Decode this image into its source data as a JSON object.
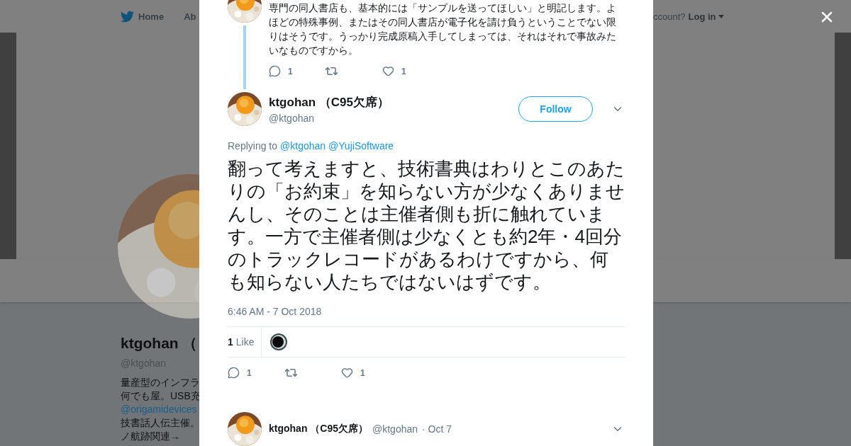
{
  "nav": {
    "home": "Home",
    "about": "Ab",
    "account_prompt": "ccount?",
    "login": "Log in"
  },
  "profile": {
    "name": "ktgohan （",
    "handle": "@ktgohan",
    "bio": [
      {
        "kind": "text",
        "text": "量産型のインフラ"
      },
      {
        "kind": "text",
        "text": "何でも屋。USB充"
      },
      {
        "kind": "link",
        "text": "@origamidevices"
      },
      {
        "kind": "text",
        "text": "技書話人伝主催。"
      },
      {
        "kind": "text",
        "text": "ノ航跡関連→"
      }
    ]
  },
  "previous_tweet": {
    "text": "専門の同人書店も、基本的には「サンプルを送ってほしい」と明記します。よほどの特殊事例、またはその同人書店が電子化を請け負うということでない限りはそうです。うっかり完成原稿入手してしまっては、それはそれで事故みたいなものですから。",
    "replies": "1",
    "likes": "1"
  },
  "tweet": {
    "name": "ktgohan （C95欠席）",
    "handle": "@ktgohan",
    "follow": "Follow",
    "replying_label": "Replying to",
    "replying_to": [
      "@ktgohan",
      "@YujiSoftware"
    ],
    "text": "翻って考えますと、技術書典はわりとこのあたりの「お約束」を知らない方が少なくありませんし、そのことは主催者側も折に触れています。一方で主催者側は少なくとも約2年・4回分のトラックレコードがあるわけですから、何も知らない人たちではないはずです。",
    "timestamp": "6:46 AM - 7 Oct 2018",
    "likes_count": "1",
    "likes_label": "Like",
    "replies": "1",
    "likes": "1"
  },
  "next_tweet": {
    "name": "ktgohan （C95欠席）",
    "handle": "@ktgohan",
    "date": "· Oct 7"
  }
}
